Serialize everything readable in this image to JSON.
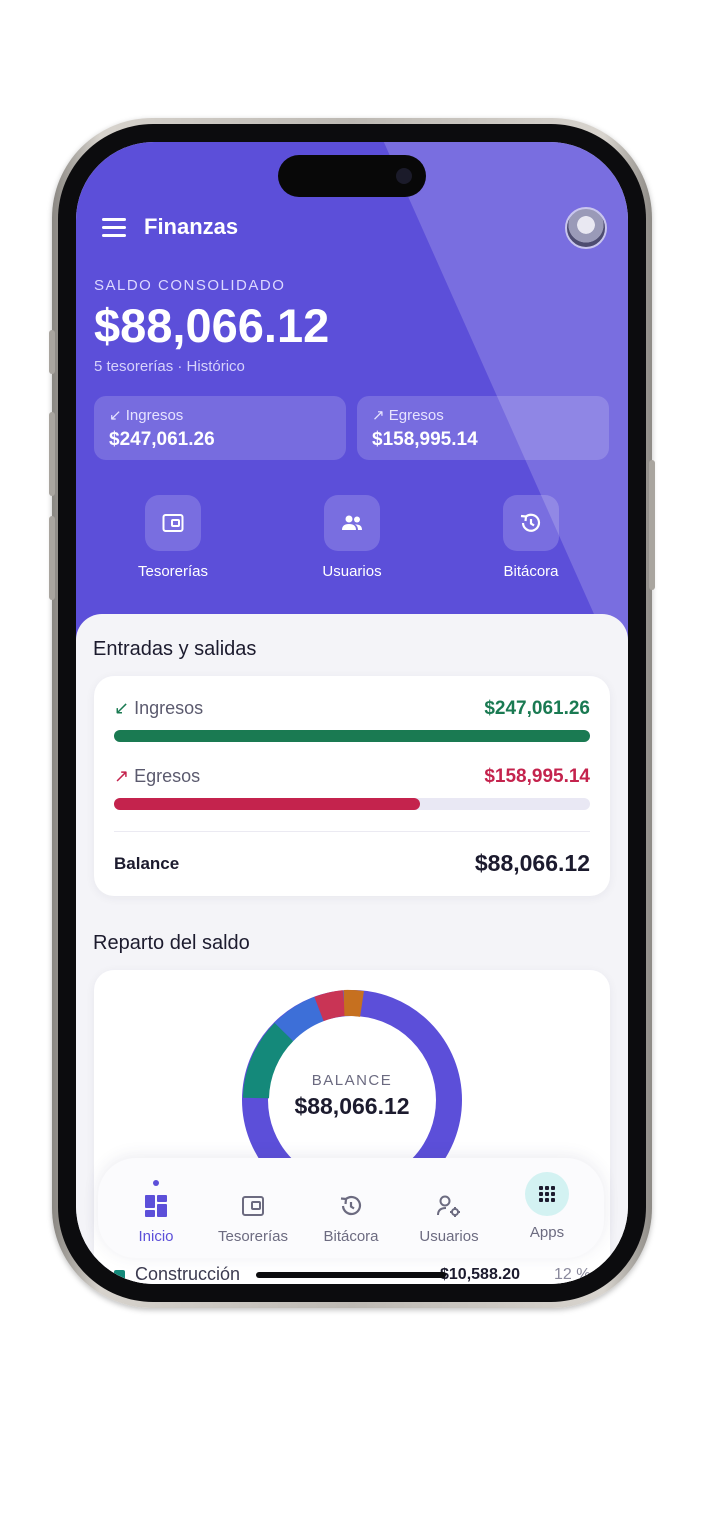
{
  "header": {
    "title": "Finanzas"
  },
  "summary": {
    "label": "SALDO CONSOLIDADO",
    "amount": "$88,066.12",
    "subtitle": "5 tesorerías · Histórico",
    "ingresos_label": "Ingresos",
    "ingresos_value": "$247,061.26",
    "egresos_label": "Egresos",
    "egresos_value": "$158,995.14"
  },
  "quick_actions": [
    {
      "label": "Tesorerías",
      "icon": "wallet-icon"
    },
    {
      "label": "Usuarios",
      "icon": "users-icon"
    },
    {
      "label": "Bitácora",
      "icon": "history-icon"
    }
  ],
  "flows": {
    "title": "Entradas y salidas",
    "ingresos_label": "Ingresos",
    "ingresos_value": "$247,061.26",
    "ingresos_fraction": 1.0,
    "egresos_label": "Egresos",
    "egresos_value": "$158,995.14",
    "egresos_fraction": 0.6436,
    "balance_label": "Balance",
    "balance_value": "$88,066.12"
  },
  "distribution": {
    "title": "Reparto del saldo",
    "center_label": "BALANCE",
    "center_value": "$88,066.12",
    "legend": [
      {
        "name": "Construcción",
        "value": "$10,588.20",
        "percent": "12 %",
        "color": "#14897a"
      }
    ]
  },
  "bottom_nav": [
    {
      "label": "Inicio",
      "icon": "dashboard-icon",
      "active": true
    },
    {
      "label": "Tesorerías",
      "icon": "wallet-icon",
      "active": false
    },
    {
      "label": "Bitácora",
      "icon": "history-icon",
      "active": false
    },
    {
      "label": "Usuarios",
      "icon": "user-settings-icon",
      "active": false
    },
    {
      "label": "Apps",
      "icon": "apps-grid-icon",
      "active": false
    }
  ],
  "colors": {
    "primary": "#5c4fd9",
    "income": "#1a7a52",
    "expense": "#c4234d",
    "text_dark": "#1c1b2e"
  }
}
